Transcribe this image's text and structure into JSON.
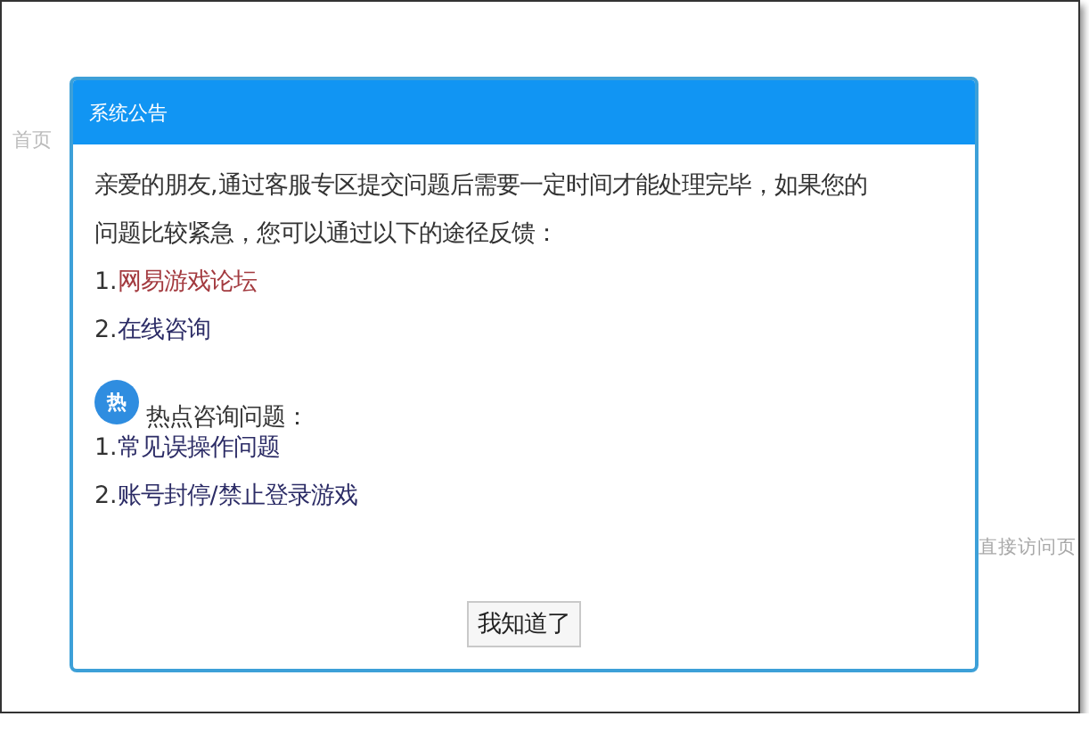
{
  "background": {
    "nav_label": "首页",
    "side_text": "直接访问页"
  },
  "dialog": {
    "title": "系统公告",
    "message": "亲爱的朋友,通过客服专区提交问题后需要一定时间才能处理完毕，如果您的问题比较紧急，您可以通过以下的途径反馈：",
    "channels": [
      {
        "number": "1.",
        "label": "网易游戏论坛",
        "color": "#a33a3f"
      },
      {
        "number": "2.",
        "label": "在线咨询",
        "color": "#2c2c66"
      }
    ],
    "hot": {
      "badge": "热",
      "heading": "热点咨询问题："
    },
    "hot_items": [
      {
        "number": "1.",
        "label": "常见误操作问题"
      },
      {
        "number": "2.",
        "label": "账号封停/禁止登录游戏"
      }
    ],
    "button": "我知道了"
  }
}
